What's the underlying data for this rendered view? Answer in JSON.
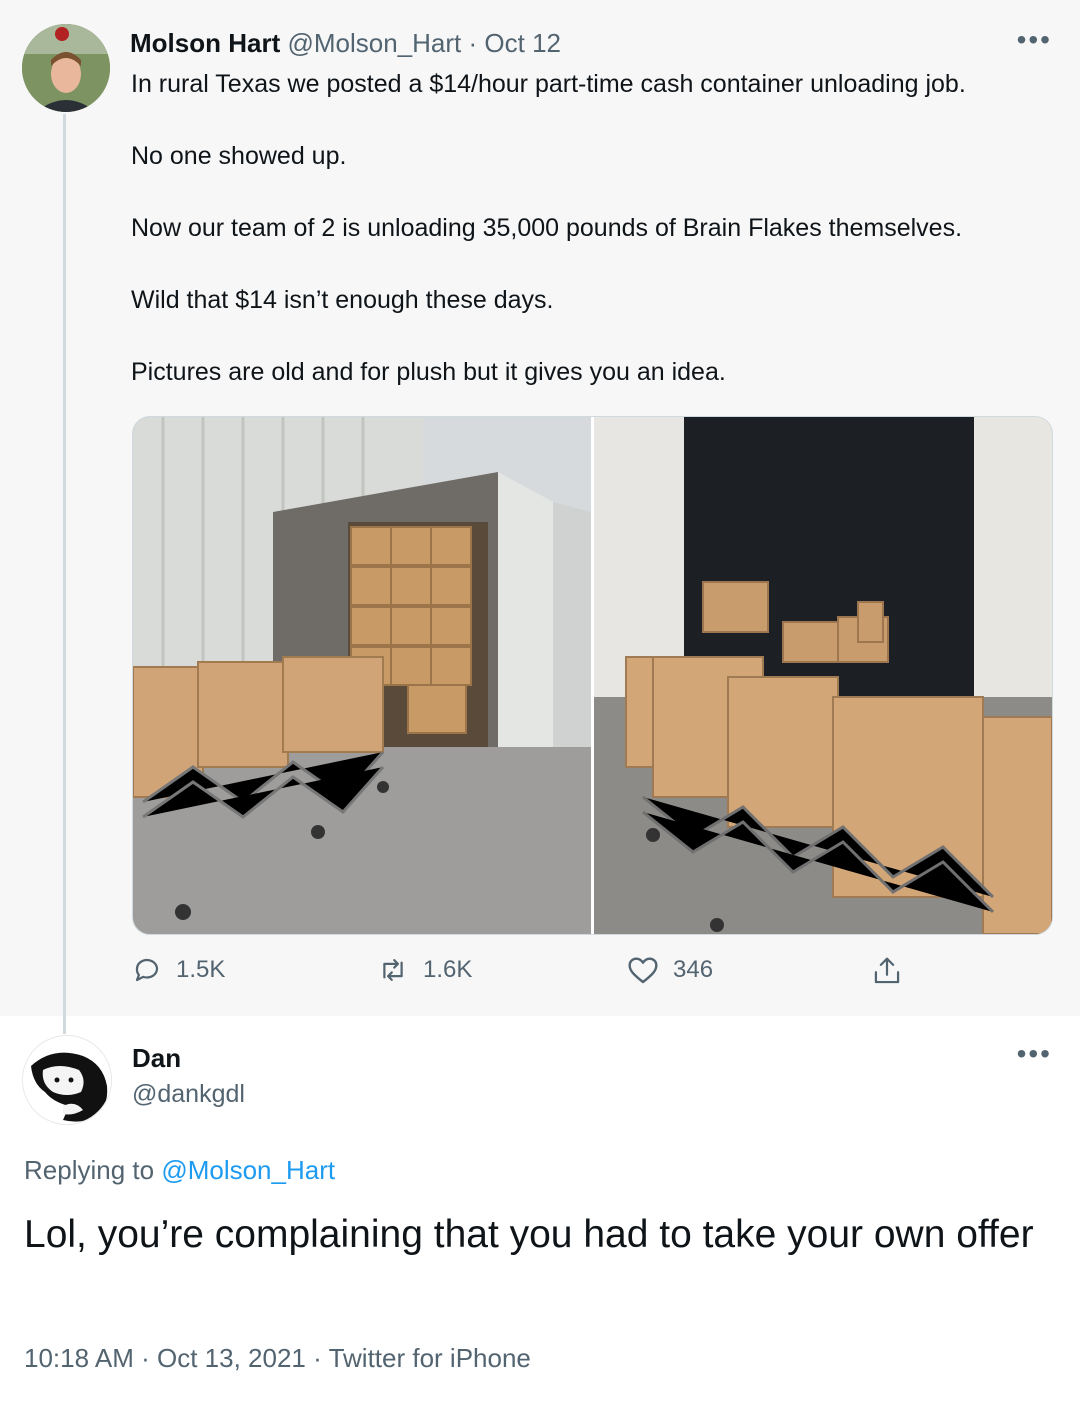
{
  "quoted_tweet": {
    "author_name": "Molson Hart",
    "author_handle": "@Molson_Hart",
    "separator": "·",
    "date": "Oct 12",
    "paragraphs": [
      "In rural Texas we posted a $14/hour part-time cash container unloading job.",
      "No one showed up.",
      "Now our team of 2 is unloading 35,000 pounds of Brain Flakes themselves.",
      "Wild that $14 isn’t enough these days.",
      "Pictures are old and for plush but it gives you an idea."
    ],
    "stats": {
      "replies": "1.5K",
      "retweets": "1.6K",
      "likes": "346"
    }
  },
  "reply_tweet": {
    "author_name": "Dan",
    "author_handle": "@dankgdl",
    "replying_prefix": "Replying to",
    "replying_to": "@Molson_Hart",
    "text": "Lol, you’re complaining that you had to take your own offer",
    "time": "10:18 AM",
    "separator": "·",
    "date": "Oct 13, 2021",
    "source": "Twitter for iPhone"
  },
  "icons": [
    "more-icon",
    "reply-icon",
    "retweet-icon",
    "like-icon",
    "share-icon"
  ],
  "colors": {
    "link": "#1d9bf0",
    "muted": "#536471",
    "text": "#0f1419",
    "thread_line": "#cfd9de"
  }
}
